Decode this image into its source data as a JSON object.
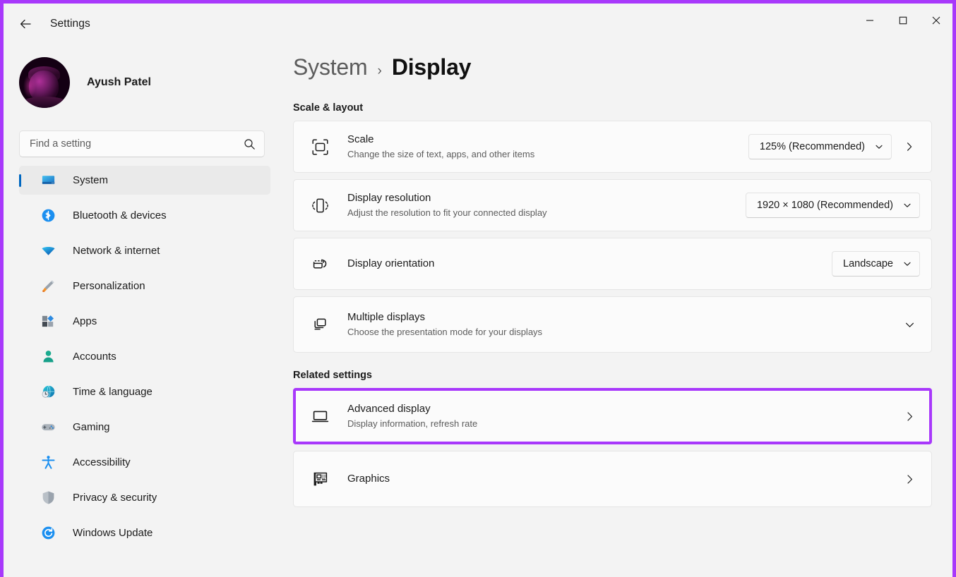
{
  "window": {
    "app_title": "Settings",
    "back_icon": "back-arrow-icon",
    "minimize_label": "—",
    "maximize_label": "□",
    "close_label": "✕",
    "highlight_color": "#a838fb",
    "accent_color": "#0067c0"
  },
  "sidebar": {
    "account": {
      "name": "Ayush Patel",
      "avatar_icon": "avatar"
    },
    "search": {
      "placeholder": "Find a setting",
      "value": "",
      "icon": "search-icon"
    },
    "items": [
      {
        "label": "System",
        "icon": "monitor-icon",
        "selected": true
      },
      {
        "label": "Bluetooth & devices",
        "icon": "bluetooth-icon",
        "selected": false
      },
      {
        "label": "Network & internet",
        "icon": "wifi-icon",
        "selected": false
      },
      {
        "label": "Personalization",
        "icon": "paintbrush-icon",
        "selected": false
      },
      {
        "label": "Apps",
        "icon": "apps-icon",
        "selected": false
      },
      {
        "label": "Accounts",
        "icon": "person-icon",
        "selected": false
      },
      {
        "label": "Time & language",
        "icon": "clock-globe-icon",
        "selected": false
      },
      {
        "label": "Gaming",
        "icon": "gamepad-icon",
        "selected": false
      },
      {
        "label": "Accessibility",
        "icon": "accessibility-icon",
        "selected": false
      },
      {
        "label": "Privacy & security",
        "icon": "shield-icon",
        "selected": false
      },
      {
        "label": "Windows Update",
        "icon": "update-icon",
        "selected": false
      }
    ]
  },
  "main": {
    "breadcrumb": {
      "parent": "System",
      "separator": "›",
      "current": "Display"
    },
    "sections": [
      {
        "title": "Scale & layout",
        "rows": [
          {
            "id": "scale",
            "icon": "scale-icon",
            "title": "Scale",
            "subtitle": "Change the size of text, apps, and other items",
            "combo": "125% (Recommended)",
            "trailing": "chevron-right"
          },
          {
            "id": "display-resolution",
            "icon": "resolution-icon",
            "title": "Display resolution",
            "subtitle": "Adjust the resolution to fit your connected display",
            "combo": "1920 × 1080 (Recommended)",
            "trailing": "none"
          },
          {
            "id": "display-orientation",
            "icon": "orientation-icon",
            "title": "Display orientation",
            "subtitle": "",
            "combo": "Landscape",
            "trailing": "none"
          },
          {
            "id": "multiple-displays",
            "icon": "multiple-displays-icon",
            "title": "Multiple displays",
            "subtitle": "Choose the presentation mode for your displays",
            "combo": "",
            "trailing": "chevron-down"
          }
        ]
      },
      {
        "title": "Related settings",
        "rows": [
          {
            "id": "advanced-display",
            "icon": "laptop-display-icon",
            "title": "Advanced display",
            "subtitle": "Display information, refresh rate",
            "combo": "",
            "trailing": "chevron-right",
            "highlighted": true
          },
          {
            "id": "graphics",
            "icon": "graphics-card-icon",
            "title": "Graphics",
            "subtitle": "",
            "combo": "",
            "trailing": "chevron-right"
          }
        ]
      }
    ]
  }
}
